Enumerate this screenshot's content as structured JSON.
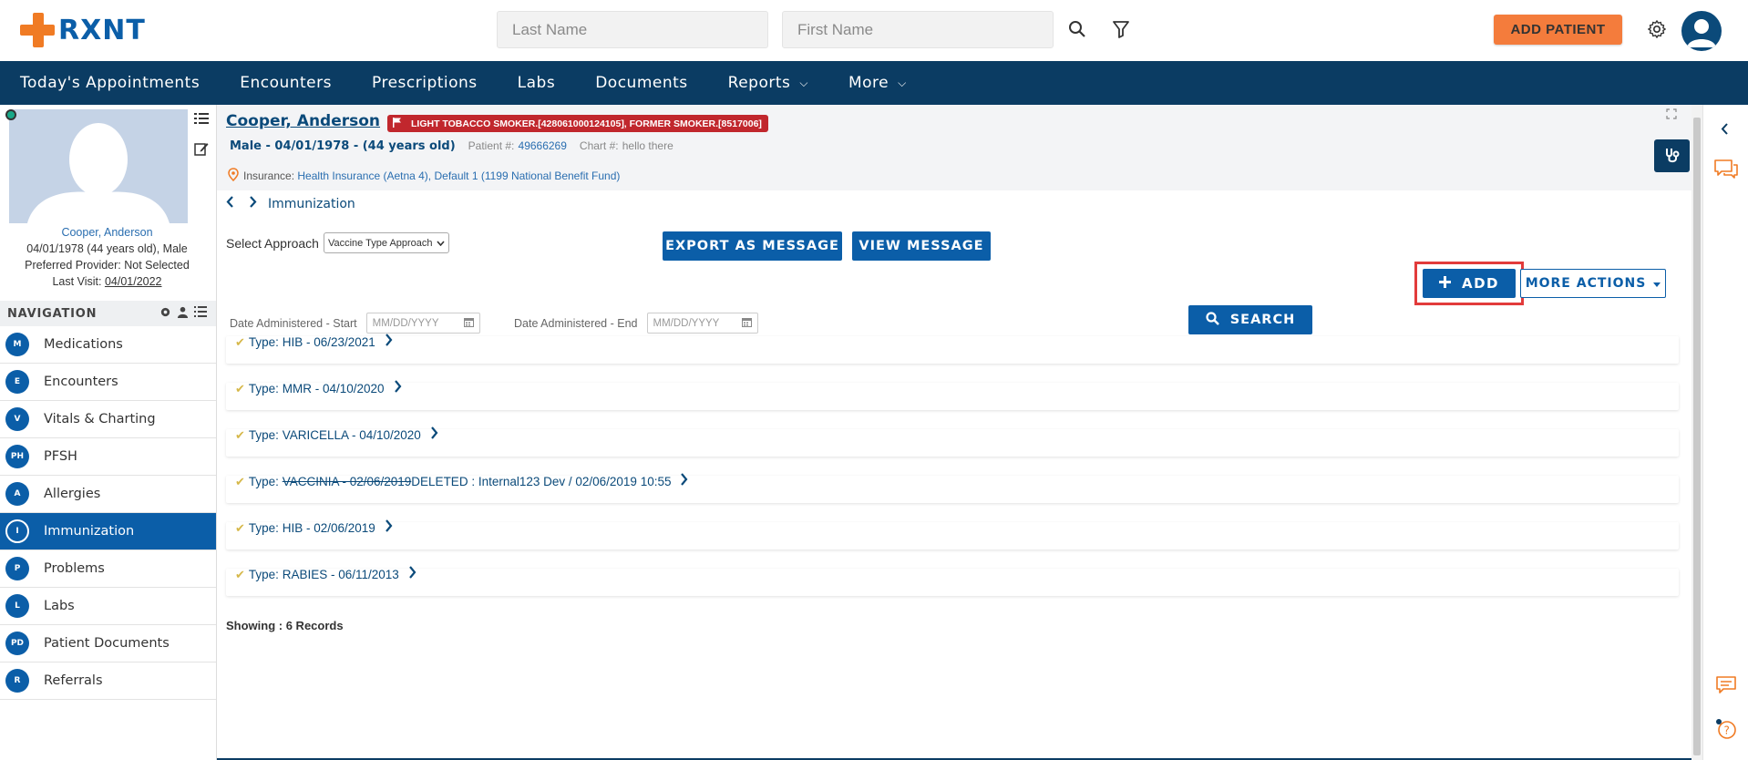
{
  "header": {
    "logo_text": "RXNT",
    "last_name_placeholder": "Last Name",
    "first_name_placeholder": "First Name",
    "add_patient_label": "ADD PATIENT",
    "brand_color": "#0b5ea8",
    "accent_color": "#f47c3c"
  },
  "navbar": {
    "items": [
      {
        "label": "Today's Appointments"
      },
      {
        "label": "Encounters"
      },
      {
        "label": "Prescriptions"
      },
      {
        "label": "Labs"
      },
      {
        "label": "Documents"
      },
      {
        "label": "Reports"
      },
      {
        "label": "More"
      }
    ]
  },
  "patient_card": {
    "name": "Cooper, Anderson",
    "dob_line": "04/01/1978 (44 years old), Male",
    "provider_line": "Preferred Provider: Not Selected",
    "last_visit_label": "Last Visit:",
    "last_visit_date": "04/01/2022"
  },
  "navigation": {
    "header": "NAVIGATION",
    "items": [
      {
        "badge": "M",
        "label": "Medications"
      },
      {
        "badge": "E",
        "label": "Encounters"
      },
      {
        "badge": "V",
        "label": "Vitals & Charting"
      },
      {
        "badge": "PH",
        "label": "PFSH"
      },
      {
        "badge": "A",
        "label": "Allergies"
      },
      {
        "badge": "I",
        "label": "Immunization"
      },
      {
        "badge": "P",
        "label": "Problems"
      },
      {
        "badge": "L",
        "label": "Labs"
      },
      {
        "badge": "PD",
        "label": "Patient Documents"
      },
      {
        "badge": "R",
        "label": "Referrals"
      }
    ],
    "active": "Immunization"
  },
  "patient_header": {
    "name": "Cooper, Anderson",
    "flag": "LIGHT TOBACCO SMOKER.[428061000124105], FORMER SMOKER.[8517006]",
    "demographics": "Male - 04/01/1978 - (44 years old)",
    "patient_no_label": "Patient #:",
    "patient_no": "49666269",
    "chart_no_label": "Chart #:",
    "chart_no": "hello there",
    "insurance_label": "Insurance:",
    "insurance_value": "Health Insurance (Aetna 4), Default 1 (1199 National Benefit Fund)"
  },
  "page": {
    "breadcrumb": "Immunization",
    "select_approach_label": "Select Approach",
    "select_approach_value": "Vaccine Type Approach",
    "export_label": "EXPORT AS MESSAGE",
    "view_message_label": "VIEW MESSAGE",
    "add_label": "ADD",
    "more_actions_label": "MORE ACTIONS",
    "date_start_label": "Date Administered - Start",
    "date_end_label": "Date Administered - End",
    "date_placeholder": "MM/DD/YYYY",
    "search_label": "SEARCH",
    "showing": "Showing : 6 Records"
  },
  "records": [
    {
      "prefix": "Type: ",
      "text": "HIB - 06/23/2021",
      "deleted": false,
      "extra": ""
    },
    {
      "prefix": "Type: ",
      "text": "MMR - 04/10/2020",
      "deleted": false,
      "extra": ""
    },
    {
      "prefix": "Type: ",
      "text": "VARICELLA - 04/10/2020",
      "deleted": false,
      "extra": ""
    },
    {
      "prefix": "Type: ",
      "text": "VACCINIA - 02/06/2019",
      "deleted": true,
      "extra": " DELETED : Internal123 Dev / 02/06/2019 10:55"
    },
    {
      "prefix": "Type: ",
      "text": "HIB - 02/06/2019",
      "deleted": false,
      "extra": ""
    },
    {
      "prefix": "Type: ",
      "text": "RABIES - 06/11/2013",
      "deleted": false,
      "extra": ""
    }
  ]
}
